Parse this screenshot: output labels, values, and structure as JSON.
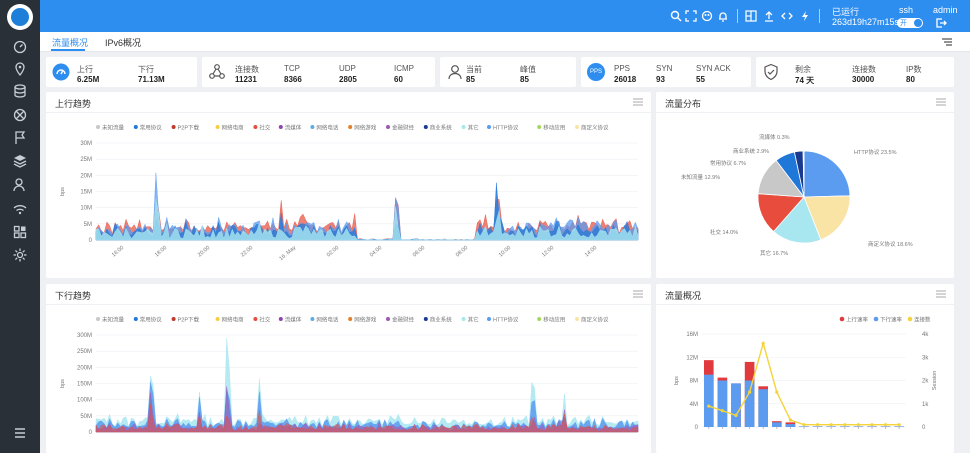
{
  "sidebar": {
    "items": [
      {
        "icon": "dashboard-icon"
      },
      {
        "icon": "location-pin-icon"
      },
      {
        "icon": "database-icon"
      },
      {
        "icon": "network-icon"
      },
      {
        "icon": "flag-icon"
      },
      {
        "icon": "layers-icon"
      },
      {
        "icon": "user-icon"
      },
      {
        "icon": "wifi-icon"
      },
      {
        "icon": "grid-icon"
      },
      {
        "icon": "settings-icon"
      },
      {
        "icon": "menu-icon"
      }
    ]
  },
  "topbar": {
    "uptime_label": "已运行",
    "uptime_value": "263d19h27m15s",
    "ssh_label": "ssh",
    "ssh_toggle": "开",
    "user": "admin"
  },
  "tabs": [
    {
      "label": "流量概况",
      "active": true
    },
    {
      "label": "IPv6概况",
      "active": false
    }
  ],
  "stats": {
    "traffic": {
      "up_label": "上行",
      "up_value": "6.25M",
      "down_label": "下行",
      "down_value": "71.13M"
    },
    "connections": {
      "conn_label": "连接数",
      "conn_value": "11231",
      "tcp_label": "TCP",
      "tcp_value": "8366",
      "udp_label": "UDP",
      "udp_value": "2805",
      "icmp_label": "ICMP",
      "icmp_value": "60"
    },
    "users": {
      "current_label": "当前",
      "current_value": "85",
      "peak_label": "峰值",
      "peak_value": "85"
    },
    "pps": {
      "badge": "PPS",
      "pps_label": "PPS",
      "pps_value": "26018",
      "syn_label": "SYN",
      "syn_value": "93",
      "synack_label": "SYN ACK",
      "synack_value": "55"
    },
    "license": {
      "remain_label": "剩余",
      "remain_value": "74 天",
      "conn_label": "连接数",
      "conn_value": "30000",
      "ip_label": "IP数",
      "ip_value": "80"
    }
  },
  "colors": {
    "accent": "#2e8ef0",
    "sidebar": "#2a3038",
    "p2p": "#e0393e",
    "protocol_blue": "#5b9bf0",
    "yellow": "#f5d33b"
  },
  "legend_categories": [
    "未知流量",
    "常用协议",
    "P2P下载",
    "网络电商",
    "社交",
    "流媒体",
    "网络电话",
    "网络游戏",
    "金融财经",
    "商业系统",
    "其它",
    "HTTP协议",
    "移动应用",
    "商定义协议"
  ],
  "legend_colors": [
    "#c8c8c8",
    "#1f77d8",
    "#c0392b",
    "#f4d03f",
    "#e74c3c",
    "#8e44ad",
    "#5dade2",
    "#e67e22",
    "#9b59b6",
    "#1a3a8f",
    "#a8e6f0",
    "#5b9bf0",
    "#a4d65e",
    "#f9e4a6"
  ],
  "upstream": {
    "title": "上行趋势",
    "ylabel": "bps",
    "y_ticks": [
      "30M",
      "25M",
      "20M",
      "15M",
      "10M",
      "5M",
      "0"
    ],
    "x_ticks": [
      "16:00",
      "18:00",
      "20:00",
      "22:00",
      "16. May",
      "02:00",
      "04:00",
      "06:00",
      "08:00",
      "10:00",
      "12:00",
      "14:00"
    ]
  },
  "downstream": {
    "title": "下行趋势",
    "ylabel": "bps",
    "y_ticks": [
      "300M",
      "250M",
      "200M",
      "150M",
      "100M",
      "50M",
      "0"
    ]
  },
  "distribution": {
    "title": "流量分布",
    "labels": [
      {
        "text": "流媒体 0.3%"
      },
      {
        "text": "商业系统 2.9%"
      },
      {
        "text": "常用协议 6.7%"
      },
      {
        "text": "未知流量 12.9%"
      },
      {
        "text": "社交 14.0%"
      },
      {
        "text": "其它 16.7%"
      },
      {
        "text": "商定义协议 18.6%"
      },
      {
        "text": "HTTP协议 23.5%"
      }
    ]
  },
  "overview": {
    "title": "流量概况",
    "legend": [
      "上行速率",
      "下行速率",
      "连接数"
    ],
    "y_left": [
      "16M",
      "12M",
      "8M",
      "4M",
      "0"
    ],
    "y_right": [
      "4k",
      "3k",
      "2k",
      "1k",
      "0"
    ],
    "ylabel_left": "bps",
    "ylabel_right": "Session"
  },
  "chart_data": [
    {
      "type": "pie",
      "title": "流量分布",
      "categories": [
        "HTTP协议",
        "商定义协议",
        "其它",
        "社交",
        "未知流量",
        "常用协议",
        "商业系统",
        "流媒体"
      ],
      "values": [
        23.5,
        18.6,
        16.7,
        14.0,
        12.9,
        6.7,
        2.9,
        0.3
      ]
    },
    {
      "type": "bar",
      "title": "流量概况",
      "series": [
        {
          "name": "上行速率",
          "values": [
            11.5,
            8.5,
            7.5,
            11.2,
            7.0,
            1.0,
            0.8,
            0.1,
            0.1,
            0.1,
            0.1,
            0.1,
            0.1,
            0.1,
            0.1
          ]
        },
        {
          "name": "下行速率",
          "values": [
            9,
            8,
            7.5,
            8,
            6.5,
            0.8,
            0.5,
            0.1,
            0.1,
            0.1,
            0.1,
            0.1,
            0.1,
            0.1,
            0.1
          ]
        },
        {
          "name": "连接数",
          "values": [
            900,
            700,
            500,
            1500,
            3600,
            1500,
            300,
            100,
            100,
            100,
            100,
            100,
            100,
            100,
            100
          ]
        }
      ],
      "ylim": [
        0,
        16
      ],
      "y2lim": [
        0,
        4000
      ]
    }
  ]
}
